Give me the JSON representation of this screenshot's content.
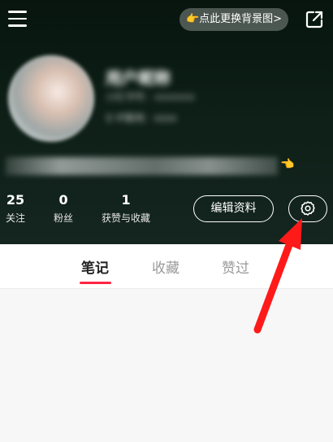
{
  "header": {
    "bg_change_label": "👉点此更换背景图>",
    "username": "用户昵称",
    "user_id": "小红书号：xxxxxxx",
    "ip_location": "♀  IP属地：xxxx",
    "bio_emoji": "👈"
  },
  "stats": [
    {
      "value": "25",
      "label": "关注"
    },
    {
      "value": "0",
      "label": "粉丝"
    },
    {
      "value": "1",
      "label": "获赞与收藏"
    }
  ],
  "actions": {
    "edit_profile_label": "编辑资料"
  },
  "tabs": [
    {
      "label": "笔记",
      "active": true
    },
    {
      "label": "收藏",
      "active": false
    },
    {
      "label": "赞过",
      "active": false
    }
  ],
  "colors": {
    "header_bg": "#0d1f17",
    "accent": "#ff2442",
    "annotation_arrow": "#ff1a1a"
  }
}
